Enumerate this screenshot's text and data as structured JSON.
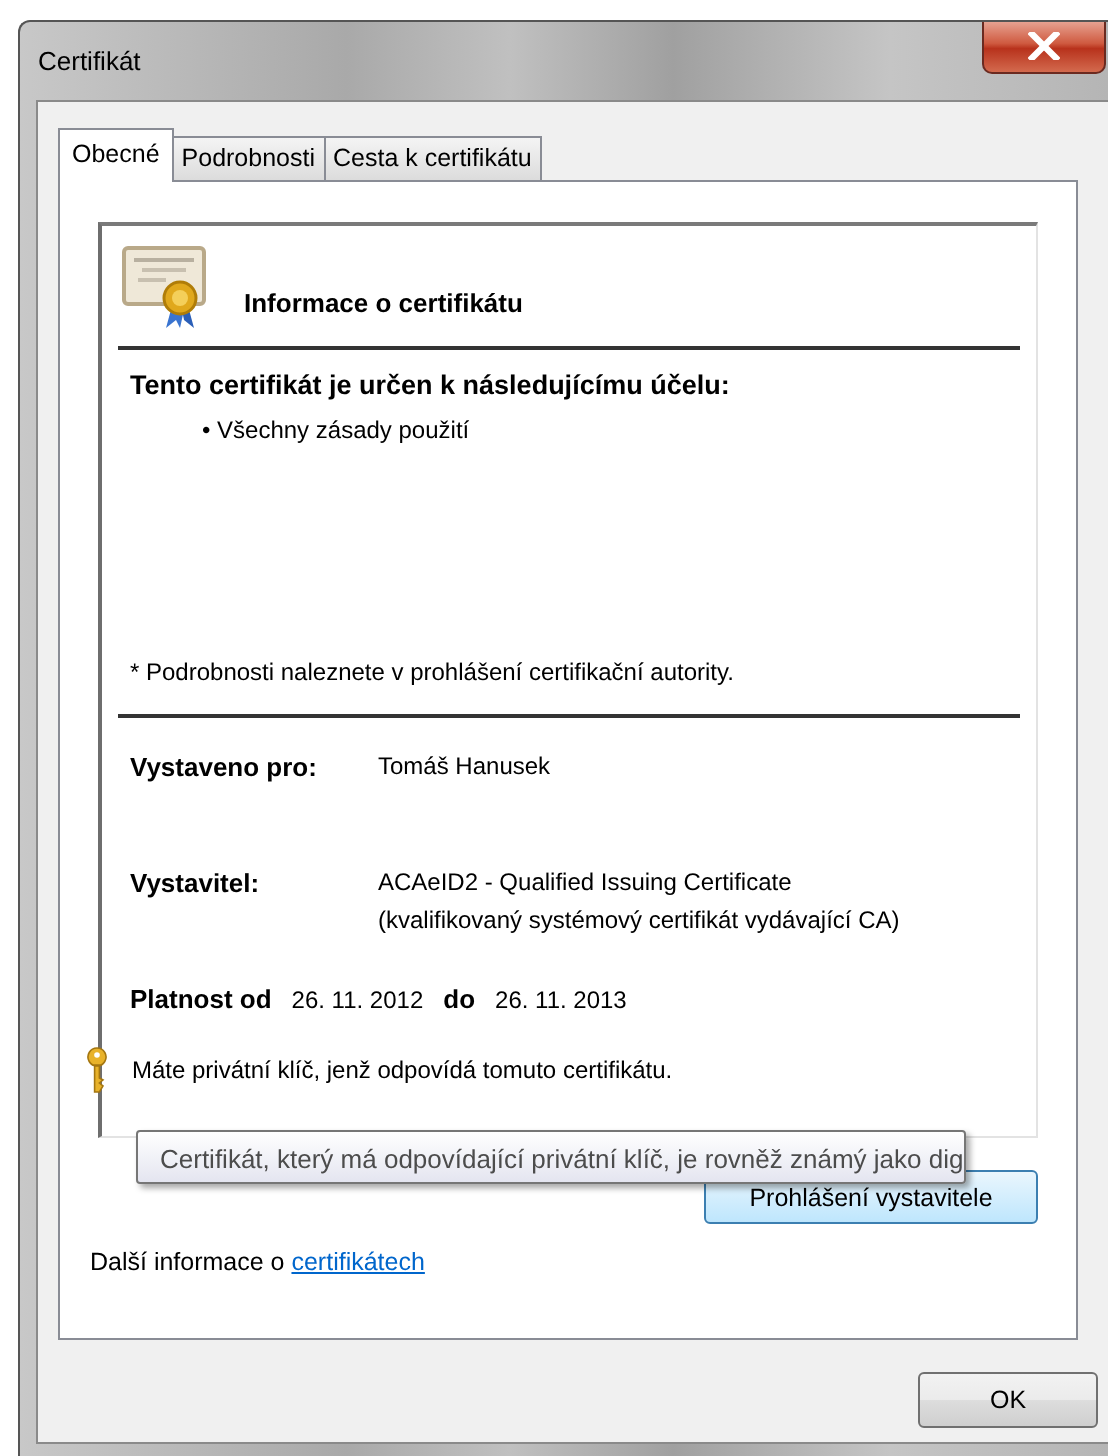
{
  "window": {
    "title": "Certifikát"
  },
  "tabs": [
    {
      "label": "Obecné",
      "selected": true
    },
    {
      "label": "Podrobnosti",
      "selected": false
    },
    {
      "label": "Cesta k certifikátu",
      "selected": false
    }
  ],
  "certificate_info": {
    "heading": "Informace o certifikátu",
    "purpose_heading": "Tento certifikát je určen k následujícímu účelu:",
    "purposes": [
      "• Všechny zásady použití"
    ],
    "note": "* Podrobnosti naleznete v prohlášení certifikační autority.",
    "issued_to": {
      "label": "Vystaveno pro:",
      "value": "Tomáš Hanusek"
    },
    "issuer": {
      "label": "Vystavitel:",
      "lines": [
        "ACAeID2 - Qualified Issuing Certificate",
        "(kvalifikovaný systémový certifikát vydávající CA)"
      ]
    },
    "validity": {
      "from_label": "Platnost od",
      "from": "26. 11. 2012",
      "to_label": "do",
      "to": "26. 11. 2013"
    },
    "private_key_note": "Máte privátní klíč, jenž odpovídá tomuto certifikátu."
  },
  "issuer_statement_button": "Prohlášení vystavitele",
  "more_info": {
    "text": "Další informace o",
    "link": "certifikátech"
  },
  "tooltip": "Certifikát, který má odpovídající privátní klíč, je rovněž známý jako dig",
  "buttons": [
    "OK"
  ]
}
